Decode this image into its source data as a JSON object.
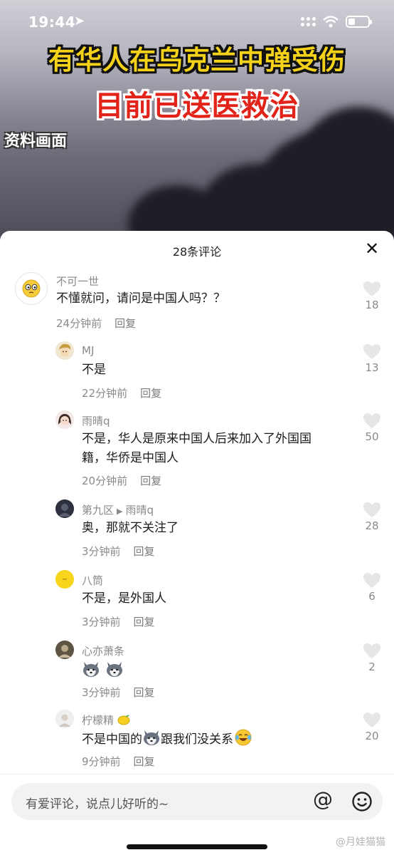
{
  "status_bar": {
    "time": "19:44"
  },
  "video": {
    "headline_line1": "有华人在乌克兰中弹受伤",
    "headline_line2": "目前已送医救治",
    "archive_tag": "资料画面"
  },
  "sheet": {
    "title": "28条评论",
    "close_icon": "close-icon"
  },
  "comments": [
    {
      "user": "不可一世",
      "text": "不懂就问，请问是中国人吗？？",
      "time": "24分钟前",
      "reply_label": "回复",
      "likes": "18",
      "avatar": "emoji-face-avatar"
    },
    {
      "user": "MJ",
      "text": "不是",
      "time": "22分钟前",
      "reply_label": "回复",
      "likes": "13",
      "avatar": "cartoon-avatar"
    },
    {
      "user": "雨晴q",
      "text_line1": "不是，华人是原来中国人后来加入了外国国",
      "text_line2": "籍，华侨是中国人",
      "time": "20分钟前",
      "reply_label": "回复",
      "likes": "50",
      "avatar": "girl-avatar"
    },
    {
      "user": "第九区",
      "reply_to": "雨晴q",
      "text": "奥，那就不关注了",
      "time": "3分钟前",
      "reply_label": "回复",
      "likes": "28",
      "avatar": "dark-avatar"
    },
    {
      "user": "八筒",
      "text": "不是，是外国人",
      "time": "3分钟前",
      "reply_label": "回复",
      "likes": "6",
      "avatar": "yellow-avatar"
    },
    {
      "user": "心亦萧条",
      "text": "",
      "time": "3分钟前",
      "reply_label": "回复",
      "likes": "2",
      "avatar": "photo-avatar"
    },
    {
      "user": "柠檬精",
      "text_a": "不是中国的",
      "text_b": "跟我们没关系",
      "time": "9分钟前",
      "reply_label": "回复",
      "likes": "20",
      "avatar": "lemon-avatar"
    }
  ],
  "input": {
    "placeholder": "有爱评论，说点儿好听的~",
    "at_label": "@"
  },
  "watermark": "@月娃猫猫"
}
